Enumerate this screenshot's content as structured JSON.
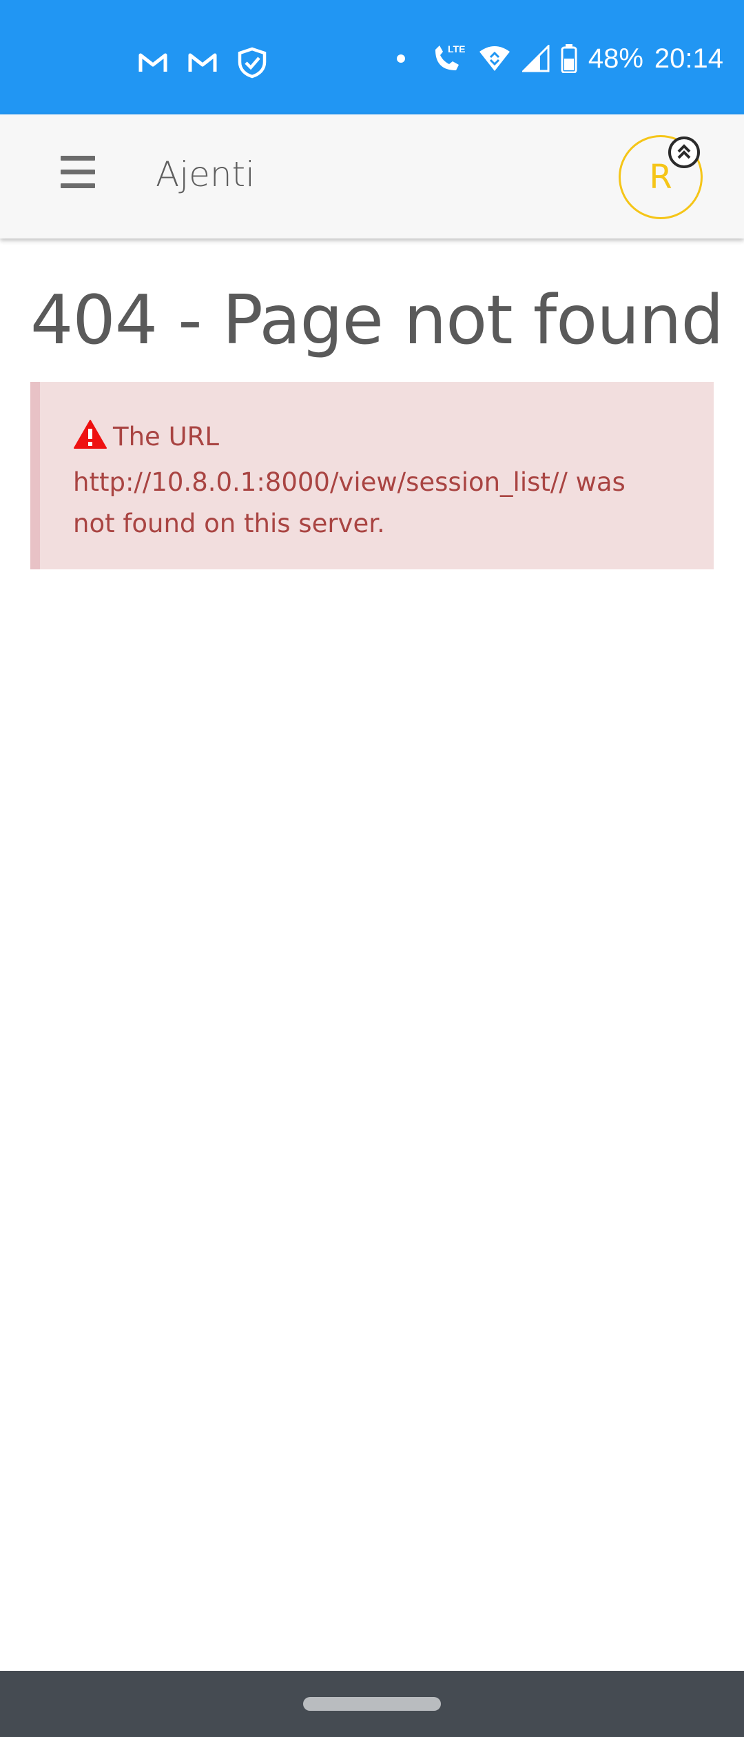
{
  "status_bar": {
    "battery": "48%",
    "time": "20:14",
    "icons_left": [
      "gmail-icon",
      "gmail-icon",
      "shield-check-icon"
    ],
    "icons_right": [
      "notification-dot-icon",
      "lte-call-icon",
      "wifi-icon",
      "signal-icon",
      "battery-icon"
    ]
  },
  "app_bar": {
    "title": "Ajenti",
    "avatar_letter": "R",
    "avatar_color": "#f5c518"
  },
  "main": {
    "heading": "404 - Page not found",
    "alert": {
      "message": "The URL http://10.8.0.1:8000/view/session_list// was not found on this server.",
      "icon": "warning-icon",
      "icon_color": "#ee1111",
      "text_color": "#a94442"
    }
  },
  "colors": {
    "status_bar": "#2196f3",
    "nav_bar": "#454b52"
  }
}
